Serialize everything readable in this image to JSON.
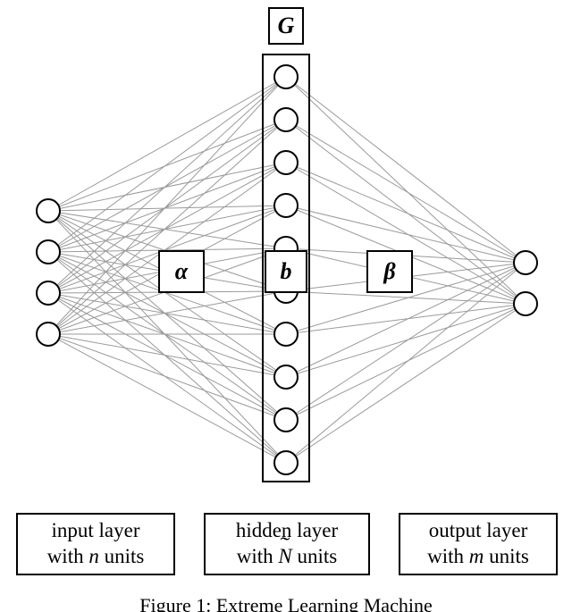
{
  "top_label": "G",
  "alpha_label": "α",
  "b_label": "b",
  "beta_label": "β",
  "input_box_line1": "input layer",
  "input_box_line2_prefix": "with ",
  "input_box_var": "n",
  "input_box_line2_suffix": " units",
  "hidden_box_line1": "hidden layer",
  "hidden_box_line2_prefix": "with ",
  "hidden_box_var": "N",
  "hidden_box_line2_suffix": " units",
  "output_box_line1": "output layer",
  "output_box_line2_prefix": "with ",
  "output_box_var": "m",
  "output_box_line2_suffix": " units",
  "caption": "Figure 1: Extreme Learning Machine"
}
